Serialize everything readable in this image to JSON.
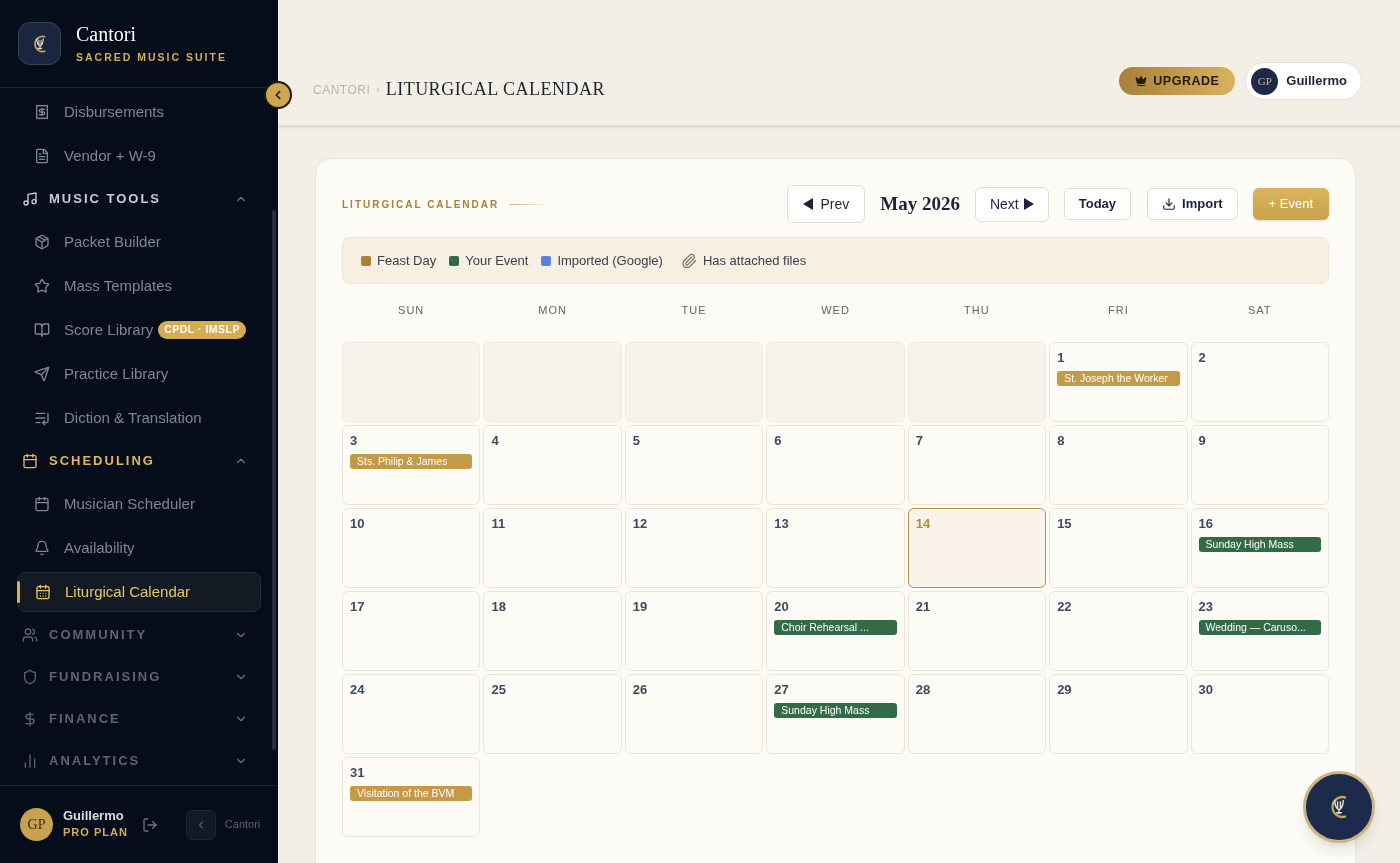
{
  "brand": {
    "name": "Cantori",
    "tagline": "SACRED MUSIC SUITE"
  },
  "sidebar": {
    "items": [
      {
        "kind": "item",
        "label": "Disbursements",
        "selected": false
      },
      {
        "kind": "item",
        "label": "Vendor + W-9",
        "selected": false
      },
      {
        "kind": "section",
        "label": "MUSIC TOOLS",
        "expanded": true,
        "active": false
      },
      {
        "kind": "item",
        "label": "Packet Builder",
        "selected": false
      },
      {
        "kind": "item",
        "label": "Mass Templates",
        "selected": false
      },
      {
        "kind": "item",
        "label": "Score Library",
        "selected": false,
        "badge": "CPDL · IMSLP"
      },
      {
        "kind": "item",
        "label": "Practice Library",
        "selected": false
      },
      {
        "kind": "item",
        "label": "Diction & Translation",
        "selected": false
      },
      {
        "kind": "section",
        "label": "SCHEDULING",
        "expanded": true,
        "active": true
      },
      {
        "kind": "item",
        "label": "Musician Scheduler",
        "selected": false
      },
      {
        "kind": "item",
        "label": "Availability",
        "selected": false
      },
      {
        "kind": "item",
        "label": "Liturgical Calendar",
        "selected": true
      },
      {
        "kind": "section",
        "label": "COMMUNITY",
        "expanded": false,
        "active": false
      },
      {
        "kind": "section",
        "label": "FUNDRAISING",
        "expanded": false,
        "active": false
      },
      {
        "kind": "section",
        "label": "FINANCE",
        "expanded": false,
        "active": false
      },
      {
        "kind": "section",
        "label": "ANALYTICS",
        "expanded": false,
        "active": false
      }
    ]
  },
  "user_footer": {
    "initials": "GP",
    "name": "Guillermo",
    "plan": "PRO PLAN",
    "tooltip": "Cantori"
  },
  "breadcrumb": {
    "root": "CANTORI",
    "separator": "›",
    "current": "LITURGICAL CALENDAR"
  },
  "header": {
    "upgrade": "UPGRADE",
    "user": {
      "initials": "GP",
      "name": "Guillermo"
    }
  },
  "calendar": {
    "label": "LITURGICAL CALENDAR",
    "prev": "Prev",
    "month": "May 2026",
    "next": "Next",
    "today": "Today",
    "import": "Import",
    "add": "+ Event",
    "legend": [
      {
        "kind": "swatch",
        "label": "Feast Day",
        "color": "#a8823a"
      },
      {
        "kind": "swatch",
        "label": "Your Event",
        "color": "#336b46"
      },
      {
        "kind": "swatch",
        "label": "Imported (Google)",
        "color": "#5b7fe0"
      },
      {
        "kind": "attachment",
        "label": "Has attached files"
      }
    ],
    "weekdays": [
      "SUN",
      "MON",
      "TUE",
      "WED",
      "THU",
      "FRI",
      "SAT"
    ],
    "weeks": [
      [
        {
          "kind": "blank"
        },
        {
          "kind": "blank"
        },
        {
          "kind": "blank"
        },
        {
          "kind": "blank"
        },
        {
          "kind": "blank"
        },
        {
          "kind": "day",
          "day": "1",
          "today": false,
          "events": [
            {
              "title": "St. Joseph the Worker",
              "color": "#c49a48"
            }
          ]
        },
        {
          "kind": "day",
          "day": "2",
          "today": false
        }
      ],
      [
        {
          "kind": "day",
          "day": "3",
          "today": false,
          "events": [
            {
              "title": "Sts. Philip & James",
              "color": "#c49a48"
            }
          ]
        },
        {
          "kind": "day",
          "day": "4",
          "today": false
        },
        {
          "kind": "day",
          "day": "5",
          "today": false
        },
        {
          "kind": "day",
          "day": "6",
          "today": false
        },
        {
          "kind": "day",
          "day": "7",
          "today": false
        },
        {
          "kind": "day",
          "day": "8",
          "today": false
        },
        {
          "kind": "day",
          "day": "9",
          "today": false
        }
      ],
      [
        {
          "kind": "day",
          "day": "10",
          "today": false
        },
        {
          "kind": "day",
          "day": "11",
          "today": false
        },
        {
          "kind": "day",
          "day": "12",
          "today": false
        },
        {
          "kind": "day",
          "day": "13",
          "today": false
        },
        {
          "kind": "day",
          "day": "14",
          "today": true
        },
        {
          "kind": "day",
          "day": "15",
          "today": false
        },
        {
          "kind": "day",
          "day": "16",
          "today": false,
          "events": [
            {
              "title": "Sunday High Mass",
              "color": "#336b46"
            }
          ]
        }
      ],
      [
        {
          "kind": "day",
          "day": "17",
          "today": false
        },
        {
          "kind": "day",
          "day": "18",
          "today": false
        },
        {
          "kind": "day",
          "day": "19",
          "today": false
        },
        {
          "kind": "day",
          "day": "20",
          "today": false,
          "events": [
            {
              "title": "Choir Rehearsal ...",
              "color": "#336b46"
            }
          ]
        },
        {
          "kind": "day",
          "day": "21",
          "today": false
        },
        {
          "kind": "day",
          "day": "22",
          "today": false
        },
        {
          "kind": "day",
          "day": "23",
          "today": false,
          "events": [
            {
              "title": "Wedding — Caruso...",
              "color": "#336b46"
            }
          ]
        }
      ],
      [
        {
          "kind": "day",
          "day": "24",
          "today": false
        },
        {
          "kind": "day",
          "day": "25",
          "today": false
        },
        {
          "kind": "day",
          "day": "26",
          "today": false
        },
        {
          "kind": "day",
          "day": "27",
          "today": false,
          "events": [
            {
              "title": "Sunday High Mass",
              "color": "#336b46"
            }
          ]
        },
        {
          "kind": "day",
          "day": "28",
          "today": false
        },
        {
          "kind": "day",
          "day": "29",
          "today": false
        },
        {
          "kind": "day",
          "day": "30",
          "today": false
        }
      ],
      [
        {
          "kind": "day",
          "day": "31",
          "today": false,
          "events": [
            {
              "title": "Visitation of the BVM",
              "color": "#c49a48"
            }
          ]
        }
      ]
    ]
  }
}
